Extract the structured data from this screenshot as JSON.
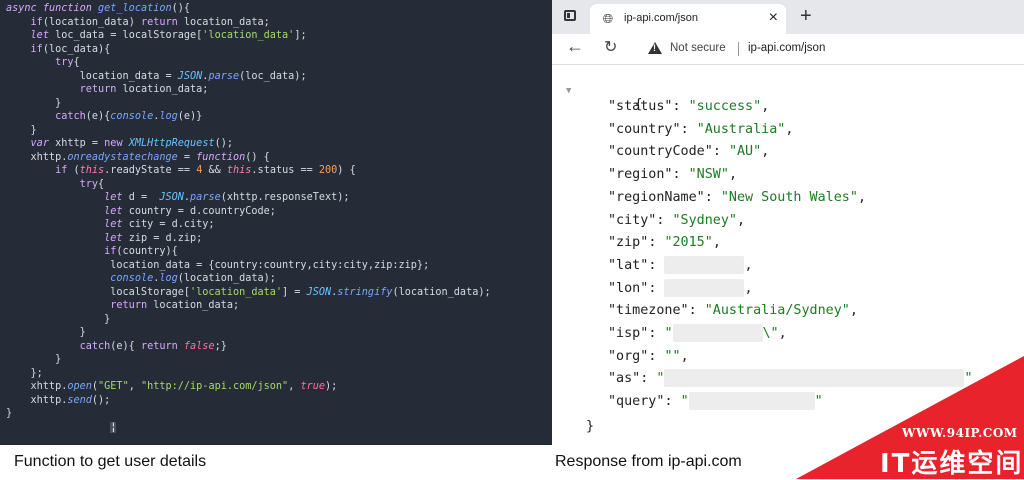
{
  "code_lines": [
    [
      [
        "kw",
        "async "
      ],
      [
        "kw",
        "function "
      ],
      [
        "fn",
        "get_location"
      ],
      [
        "plain",
        "(){"
      ]
    ],
    [
      [
        "plain",
        "    "
      ],
      [
        "kwp",
        "if"
      ],
      [
        "plain",
        "(location_data) "
      ],
      [
        "kwp",
        "return "
      ],
      [
        "plain",
        "location_data;"
      ]
    ],
    [
      [
        "plain",
        "    "
      ],
      [
        "kw",
        "let "
      ],
      [
        "plain",
        "loc_data = localStorage["
      ],
      [
        "str",
        "'location_data'"
      ],
      [
        "plain",
        "];"
      ]
    ],
    [
      [
        "plain",
        "    "
      ],
      [
        "kwp",
        "if"
      ],
      [
        "plain",
        "(loc_data){"
      ]
    ],
    [
      [
        "plain",
        "        "
      ],
      [
        "kwp",
        "try"
      ],
      [
        "plain",
        "{"
      ]
    ],
    [
      [
        "plain",
        "            location_data = "
      ],
      [
        "cls",
        "JSON"
      ],
      [
        "plain",
        "."
      ],
      [
        "fn",
        "parse"
      ],
      [
        "plain",
        "(loc_data);"
      ]
    ],
    [
      [
        "plain",
        "            "
      ],
      [
        "kwp",
        "return "
      ],
      [
        "plain",
        "location_data;"
      ]
    ],
    [
      [
        "plain",
        "        }"
      ]
    ],
    [
      [
        "plain",
        "        "
      ],
      [
        "kwp",
        "catch"
      ],
      [
        "plain",
        "(e){"
      ],
      [
        "fn",
        "console"
      ],
      [
        "plain",
        "."
      ],
      [
        "fn",
        "log"
      ],
      [
        "plain",
        "(e)}"
      ]
    ],
    [
      [
        "plain",
        "    }"
      ]
    ],
    [
      [
        "plain",
        "    "
      ],
      [
        "kw",
        "var "
      ],
      [
        "plain",
        "xhttp = "
      ],
      [
        "kwp",
        "new "
      ],
      [
        "cls",
        "XMLHttpRequest"
      ],
      [
        "plain",
        "();"
      ]
    ],
    [
      [
        "plain",
        "    xhttp."
      ],
      [
        "fn",
        "onreadystatechange"
      ],
      [
        "plain",
        " = "
      ],
      [
        "kw",
        "function"
      ],
      [
        "plain",
        "() {"
      ]
    ],
    [
      [
        "plain",
        "        "
      ],
      [
        "kwp",
        "if "
      ],
      [
        "plain",
        "("
      ],
      [
        "this",
        "this"
      ],
      [
        "plain",
        ".readyState == "
      ],
      [
        "num",
        "4"
      ],
      [
        "plain",
        " && "
      ],
      [
        "this",
        "this"
      ],
      [
        "plain",
        ".status == "
      ],
      [
        "num",
        "200"
      ],
      [
        "plain",
        ") {"
      ]
    ],
    [
      [
        "plain",
        "            "
      ],
      [
        "kwp",
        "try"
      ],
      [
        "plain",
        "{"
      ]
    ],
    [
      [
        "plain",
        "                "
      ],
      [
        "kw",
        "let "
      ],
      [
        "plain",
        "d =  "
      ],
      [
        "cls",
        "JSON"
      ],
      [
        "plain",
        "."
      ],
      [
        "fn",
        "parse"
      ],
      [
        "plain",
        "(xhttp.responseText);"
      ]
    ],
    [
      [
        "plain",
        "                "
      ],
      [
        "kw",
        "let "
      ],
      [
        "plain",
        "country = d.countryCode;"
      ]
    ],
    [
      [
        "plain",
        "                "
      ],
      [
        "kw",
        "let "
      ],
      [
        "plain",
        "city = d.city;"
      ]
    ],
    [
      [
        "plain",
        "                "
      ],
      [
        "kw",
        "let "
      ],
      [
        "plain",
        "zip = d.zip;"
      ]
    ],
    [
      [
        "plain",
        "                "
      ],
      [
        "kwp",
        "if"
      ],
      [
        "plain",
        "(country){"
      ]
    ],
    [
      [
        "plain",
        "                 location_data = {country:country,city:city,zip:zip};"
      ]
    ],
    [
      [
        "plain",
        "                 "
      ],
      [
        "fn",
        "console"
      ],
      [
        "plain",
        "."
      ],
      [
        "fn",
        "log"
      ],
      [
        "plain",
        "(location_data);"
      ]
    ],
    [
      [
        "plain",
        "                 localStorage["
      ],
      [
        "str",
        "'location_data'"
      ],
      [
        "plain",
        "] = "
      ],
      [
        "cls",
        "JSON"
      ],
      [
        "plain",
        "."
      ],
      [
        "fn",
        "stringify"
      ],
      [
        "plain",
        "(location_data);"
      ]
    ],
    [
      [
        "plain",
        "                 "
      ],
      [
        "kwp",
        "return "
      ],
      [
        "plain",
        "location_data;"
      ]
    ],
    [
      [
        "plain",
        "                }"
      ]
    ],
    [
      [
        "plain",
        "            }"
      ]
    ],
    [
      [
        "plain",
        "            "
      ],
      [
        "kwp",
        "catch"
      ],
      [
        "plain",
        "(e){ "
      ],
      [
        "kwp",
        "return "
      ],
      [
        "bool",
        "false"
      ],
      [
        "plain",
        ";}"
      ]
    ],
    [
      [
        "plain",
        "        }"
      ]
    ],
    [
      [
        "plain",
        "    };"
      ]
    ],
    [
      [
        "plain",
        "    xhttp."
      ],
      [
        "fn",
        "open"
      ],
      [
        "plain",
        "("
      ],
      [
        "str",
        "\"GET\""
      ],
      [
        "plain",
        ", "
      ],
      [
        "str",
        "\"http://ip-api.com/json\""
      ],
      [
        "plain",
        ", "
      ],
      [
        "bool",
        "true"
      ],
      [
        "plain",
        ");"
      ]
    ],
    [
      [
        "plain",
        "    xhttp."
      ],
      [
        "fn",
        "send"
      ],
      [
        "plain",
        "();"
      ]
    ],
    [
      [
        "plain",
        "}"
      ]
    ],
    [
      [
        "plain",
        "                 "
      ],
      [
        "hi",
        "¦"
      ],
      [
        "plain",
        "  "
      ]
    ]
  ],
  "browser": {
    "tab_title": "ip-api.com/json",
    "tab_close": "×",
    "new_tab": "+",
    "back": "←",
    "reload": "↻",
    "not_secure": "Not secure",
    "url": "ip-api.com/json",
    "icons": {
      "favicon": "globe-icon",
      "tab_switcher": "tab-switcher-icon",
      "warning": "warning-icon"
    }
  },
  "json_view": {
    "open": "{",
    "close": "}",
    "toggle": "▼",
    "entries": [
      {
        "key": "\"status\"",
        "value": "\"success\"",
        "type": "str",
        "comma": ","
      },
      {
        "key": "\"country\"",
        "value": "\"Australia\"",
        "type": "str",
        "comma": ","
      },
      {
        "key": "\"countryCode\"",
        "value": "\"AU\"",
        "type": "str",
        "comma": ","
      },
      {
        "key": "\"region\"",
        "value": "\"NSW\"",
        "type": "str",
        "comma": ","
      },
      {
        "key": "\"regionName\"",
        "value": "\"New South Wales\"",
        "type": "str",
        "comma": ","
      },
      {
        "key": "\"city\"",
        "value": "\"Sydney\"",
        "type": "str",
        "comma": ","
      },
      {
        "key": "\"zip\"",
        "value": "\"2015\"",
        "type": "str",
        "comma": ","
      },
      {
        "key": "\"lat\"",
        "value": "",
        "type": "redacted-num",
        "comma": ","
      },
      {
        "key": "\"lon\"",
        "value": "",
        "type": "redacted-num",
        "comma": ","
      },
      {
        "key": "\"timezone\"",
        "value": "\"Australia/Sydney\"",
        "type": "str",
        "comma": ","
      },
      {
        "key": "\"isp\"",
        "value": "\"",
        "tail": "\\\"",
        "type": "redacted-str",
        "comma": ","
      },
      {
        "key": "\"org\"",
        "value": "\"\"",
        "type": "str",
        "comma": ","
      },
      {
        "key": "\"as\"",
        "value": "\"",
        "tail": "\"",
        "type": "redacted-str",
        "comma": ""
      },
      {
        "key": "\"query\"",
        "value": "\"",
        "tail": "\"",
        "type": "redacted-str",
        "comma": ""
      }
    ]
  },
  "captions": {
    "left": "Function to get user details",
    "right": "Response from ip-api.com"
  },
  "watermark": {
    "url": "WWW.94IP.COM",
    "name": "IT运维空间",
    "color": "#e8232b"
  }
}
